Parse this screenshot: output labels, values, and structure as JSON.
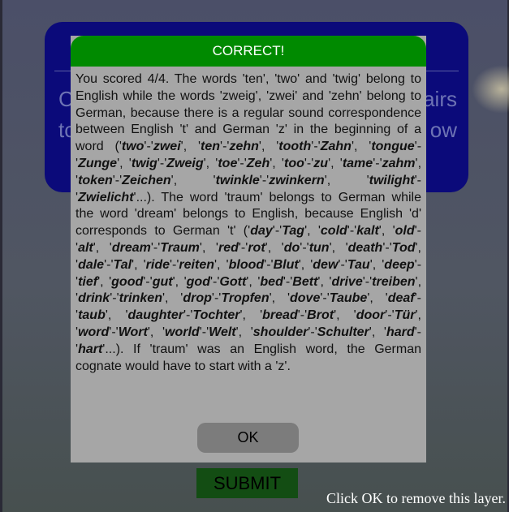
{
  "modal": {
    "title": "CORRECT!",
    "ok_label": "OK",
    "body_segments": [
      {
        "t": "You scored 4/4. The words 'ten', 'two' and 'twig' belong to English while the words 'zweig', 'zwei' and 'zehn' belong to German, because there is a regular sound correspondence between English 't' and German 'z' in the beginning of a word ('"
      },
      {
        "b": "two"
      },
      {
        "t": "'-'"
      },
      {
        "b": "zwei"
      },
      {
        "t": "', '"
      },
      {
        "b": "ten"
      },
      {
        "t": "'-'"
      },
      {
        "b": "zehn"
      },
      {
        "t": "', '"
      },
      {
        "b": "tooth"
      },
      {
        "t": "'-'"
      },
      {
        "b": "Zahn"
      },
      {
        "t": "', '"
      },
      {
        "b": "tongue"
      },
      {
        "t": "'-'"
      },
      {
        "b": "Zunge"
      },
      {
        "t": "', '"
      },
      {
        "b": "twig"
      },
      {
        "t": "'-'"
      },
      {
        "b": "Zweig"
      },
      {
        "t": "', '"
      },
      {
        "b": "toe"
      },
      {
        "t": "'-'"
      },
      {
        "b": "Zeh"
      },
      {
        "t": "', '"
      },
      {
        "b": "too"
      },
      {
        "t": "'-'"
      },
      {
        "b": "zu"
      },
      {
        "t": "', '"
      },
      {
        "b": "tame"
      },
      {
        "t": "'-'"
      },
      {
        "b": "zahm"
      },
      {
        "t": "', '"
      },
      {
        "b": "token"
      },
      {
        "t": "'-'"
      },
      {
        "b": "Zeichen"
      },
      {
        "t": "', '"
      },
      {
        "b": "twinkle"
      },
      {
        "t": "'-'"
      },
      {
        "b": "zwinkern"
      },
      {
        "t": "', '"
      },
      {
        "b": "twilight"
      },
      {
        "t": "'-'"
      },
      {
        "b": "Zwielicht"
      },
      {
        "t": "'...). The word 'traum' belongs to German while the word 'dream' belongs to English, because English 'd' corresponds to German 't' ('"
      },
      {
        "b": "day"
      },
      {
        "t": "'-'"
      },
      {
        "b": "Tag"
      },
      {
        "t": "', '"
      },
      {
        "b": "cold"
      },
      {
        "t": "'-'"
      },
      {
        "b": "kalt"
      },
      {
        "t": "', '"
      },
      {
        "b": "old"
      },
      {
        "t": "'-'"
      },
      {
        "b": "alt"
      },
      {
        "t": "', '"
      },
      {
        "b": "dream"
      },
      {
        "t": "'-'"
      },
      {
        "b": "Traum"
      },
      {
        "t": "', '"
      },
      {
        "b": "red"
      },
      {
        "t": "'-'"
      },
      {
        "b": "rot"
      },
      {
        "t": "', '"
      },
      {
        "b": "do"
      },
      {
        "t": "'-'"
      },
      {
        "b": "tun"
      },
      {
        "t": "', '"
      },
      {
        "b": "death"
      },
      {
        "t": "'-'"
      },
      {
        "b": "Tod"
      },
      {
        "t": "', '"
      },
      {
        "b": "dale"
      },
      {
        "t": "'-'"
      },
      {
        "b": "Tal"
      },
      {
        "t": "', '"
      },
      {
        "b": "ride"
      },
      {
        "t": "'-'"
      },
      {
        "b": "reiten"
      },
      {
        "t": "', '"
      },
      {
        "b": "blood"
      },
      {
        "t": "'-'"
      },
      {
        "b": "Blut"
      },
      {
        "t": "', '"
      },
      {
        "b": "dew"
      },
      {
        "t": "'-'"
      },
      {
        "b": "Tau"
      },
      {
        "t": "', '"
      },
      {
        "b": "deep"
      },
      {
        "t": "'-'"
      },
      {
        "b": "tief"
      },
      {
        "t": "', '"
      },
      {
        "b": "good"
      },
      {
        "t": "'-'"
      },
      {
        "b": "gut"
      },
      {
        "t": "', '"
      },
      {
        "b": "god"
      },
      {
        "t": "'-'"
      },
      {
        "b": "Gott"
      },
      {
        "t": "', '"
      },
      {
        "b": "bed"
      },
      {
        "t": "'-'"
      },
      {
        "b": "Bett"
      },
      {
        "t": "', '"
      },
      {
        "b": "drive"
      },
      {
        "t": "'-'"
      },
      {
        "b": "treiben"
      },
      {
        "t": "', '"
      },
      {
        "b": "drink"
      },
      {
        "t": "'-'"
      },
      {
        "b": "trinken"
      },
      {
        "t": "', '"
      },
      {
        "b": "drop"
      },
      {
        "t": "'-'"
      },
      {
        "b": "Tropfen"
      },
      {
        "t": "', '"
      },
      {
        "b": "dove"
      },
      {
        "t": "'-'"
      },
      {
        "b": "Taube"
      },
      {
        "t": "', '"
      },
      {
        "b": "deaf"
      },
      {
        "t": "'-'"
      },
      {
        "b": "taub"
      },
      {
        "t": "', '"
      },
      {
        "b": "daughter"
      },
      {
        "t": "'-'"
      },
      {
        "b": "Tochter"
      },
      {
        "t": "', '"
      },
      {
        "b": "bread"
      },
      {
        "t": "'-'"
      },
      {
        "b": "Brot"
      },
      {
        "t": "', '"
      },
      {
        "b": "door"
      },
      {
        "t": "'-'"
      },
      {
        "b": "Tür"
      },
      {
        "t": "', '"
      },
      {
        "b": "word"
      },
      {
        "t": "'-'"
      },
      {
        "b": "Wort"
      },
      {
        "t": "', '"
      },
      {
        "b": "world"
      },
      {
        "t": "'-'"
      },
      {
        "b": "Welt"
      },
      {
        "t": "', '"
      },
      {
        "b": "shoulder"
      },
      {
        "t": "'-'"
      },
      {
        "b": "Schulter"
      },
      {
        "t": "', '"
      },
      {
        "b": "hard"
      },
      {
        "t": "'-'"
      },
      {
        "b": "hart"
      },
      {
        "t": "'...). If 'traum' was an English word, the German cognate would have to start with a 'z'."
      }
    ]
  },
  "background_card": {
    "left_fragments": [
      "C",
      "tc"
    ],
    "right_fragments": [
      "airs",
      "ow"
    ]
  },
  "submit_label": "SUBMIT",
  "layer_hint": "Click OK to remove this layer.",
  "colors": {
    "header_green": "#008a00",
    "modal_gray": "#a6a6a6",
    "card_blue": "#0b0a7a",
    "submit_green": "#134d13"
  }
}
